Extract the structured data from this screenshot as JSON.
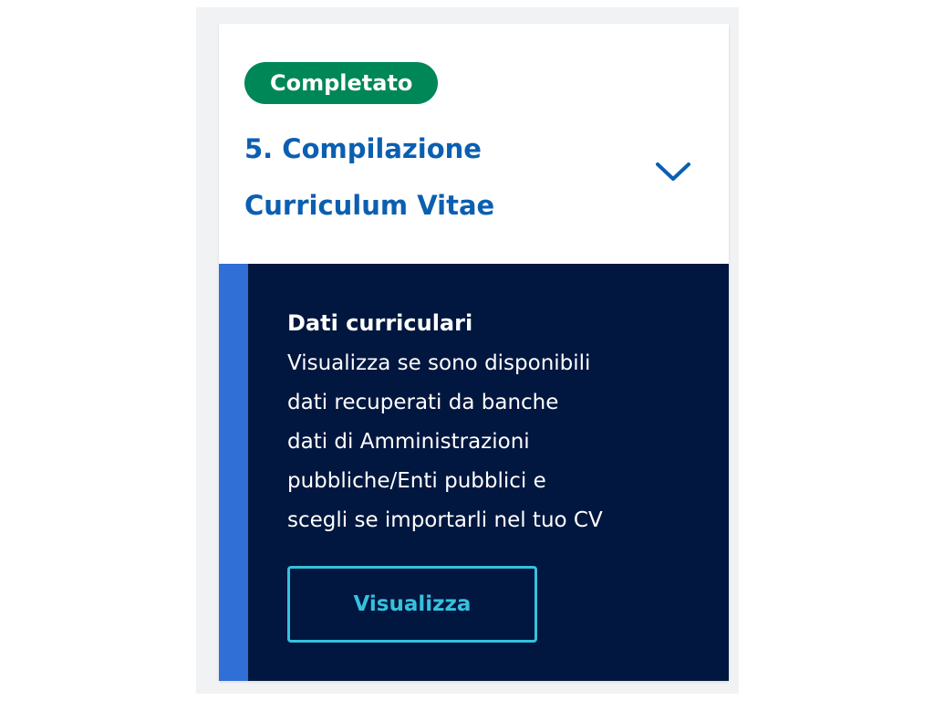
{
  "step": {
    "status_label": "Completato",
    "title": "5. Compilazione Curriculum Vitae",
    "toggle_icon": "chevron-down-icon"
  },
  "section": {
    "title": "Dati curriculari",
    "description_lines": [
      "Visualizza se sono disponibili",
      "dati recuperati da banche",
      "dati di Amministrazioni",
      "pubbliche/Enti pubblici e",
      "scegli se importarli nel tuo CV"
    ],
    "button_label": "Visualizza"
  },
  "colors": {
    "badge_green": "#008758",
    "title_blue": "#0b5fb0",
    "panel_navy": "#02173f",
    "accent_blue": "#2f6fd6",
    "button_cyan": "#36c1dd"
  }
}
